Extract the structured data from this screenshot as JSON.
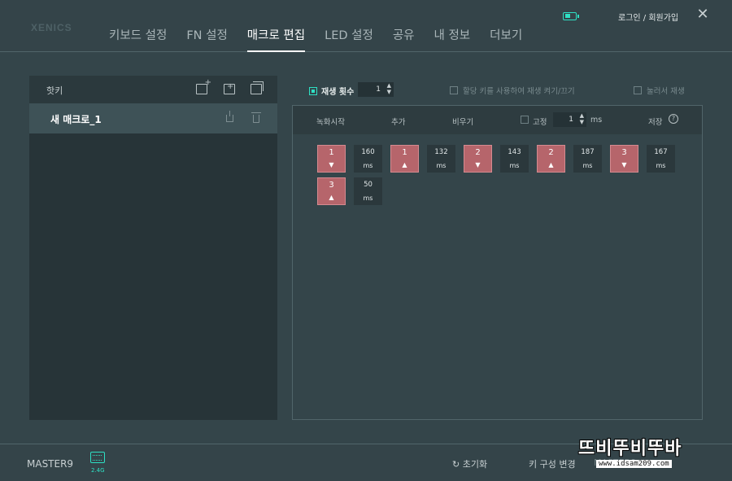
{
  "app": {
    "logo": "XENICS",
    "login_label": "로그인 / 회원가입",
    "close_glyph": "✕",
    "accent_color": "#2ee0c4",
    "key_color": "#b6656b"
  },
  "nav": {
    "tabs": [
      {
        "label": "키보드 설정",
        "active": false
      },
      {
        "label": "FN 설정",
        "active": false
      },
      {
        "label": "매크로 편집",
        "active": true
      },
      {
        "label": "LED 설정",
        "active": false
      },
      {
        "label": "공유",
        "active": false
      },
      {
        "label": "내 정보",
        "active": false
      },
      {
        "label": "더보기",
        "active": false
      }
    ]
  },
  "left_panel": {
    "title": "핫키",
    "icons": [
      "new-file-icon",
      "new-folder-icon",
      "copy-icon"
    ],
    "macros": [
      {
        "name": "새 매크로_1",
        "selected": true
      }
    ]
  },
  "controls": {
    "play_count_label": "재생 횟수",
    "play_count_value": "1",
    "assigned_toggle_label": "할당 키를 사용하여 재생 켜기/끄기",
    "hold_play_label": "눌러서 재생"
  },
  "editor": {
    "header": {
      "record_label": "녹화시작",
      "add_label": "추가",
      "clear_label": "비우기",
      "fixed_label": "고정",
      "fixed_value": "1",
      "fixed_unit": "ms",
      "save_label": "저장",
      "help_glyph": "?"
    },
    "events": [
      {
        "key": "1",
        "dir": "▼",
        "delay": "160",
        "unit": "ms"
      },
      {
        "key": "1",
        "dir": "▲",
        "delay": "132",
        "unit": "ms"
      },
      {
        "key": "2",
        "dir": "▼",
        "delay": "143",
        "unit": "ms"
      },
      {
        "key": "2",
        "dir": "▲",
        "delay": "187",
        "unit": "ms"
      },
      {
        "key": "3",
        "dir": "▼",
        "delay": "167",
        "unit": "ms"
      },
      {
        "key": "3",
        "dir": "▲",
        "delay": "50",
        "unit": "ms"
      }
    ]
  },
  "bottom": {
    "device_name": "MASTER9",
    "connection_label": "2.4G",
    "reset_label": "초기화",
    "key_config_label": "키 구성 변경",
    "faint_device": "MASTER9"
  },
  "watermark": {
    "title": "뜨비뚜비뚜바",
    "url": "www.idsam209.com"
  }
}
